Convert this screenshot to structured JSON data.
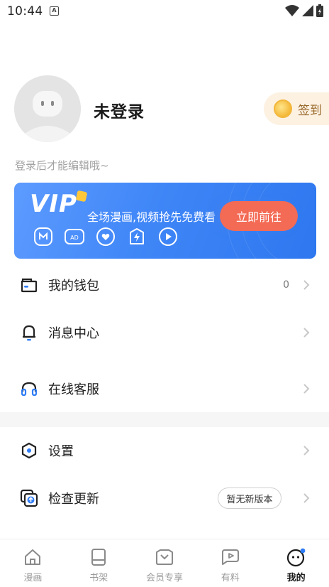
{
  "status_bar": {
    "time": "10:44",
    "notification_letter": "A"
  },
  "profile": {
    "username": "未登录",
    "checkin_label": "签到",
    "hint": "登录后才能编辑哦~"
  },
  "vip": {
    "logo": "VIP",
    "promo_text": "全场漫画,视频抢先免费看",
    "button_label": "立即前往"
  },
  "menu": {
    "wallet": {
      "label": "我的钱包",
      "value": "0"
    },
    "messages": {
      "label": "消息中心"
    },
    "service": {
      "label": "在线客服"
    },
    "settings": {
      "label": "设置"
    },
    "update": {
      "label": "检查更新",
      "badge": "暂无新版本"
    }
  },
  "bottom_nav": {
    "items": [
      {
        "label": "漫画",
        "icon": "house-icon"
      },
      {
        "label": "书架",
        "icon": "bookshelf-icon"
      },
      {
        "label": "会员专享",
        "icon": "crown-icon"
      },
      {
        "label": "有料",
        "icon": "play-bubble-icon"
      },
      {
        "label": "我的",
        "icon": "smiley-face-icon",
        "active": true
      }
    ]
  },
  "colors": {
    "vip_blue": "#3f86f7",
    "vip_button": "#f36a55",
    "accent_blue": "#2f7df6",
    "checkin_bg": "#fdf1e2"
  }
}
